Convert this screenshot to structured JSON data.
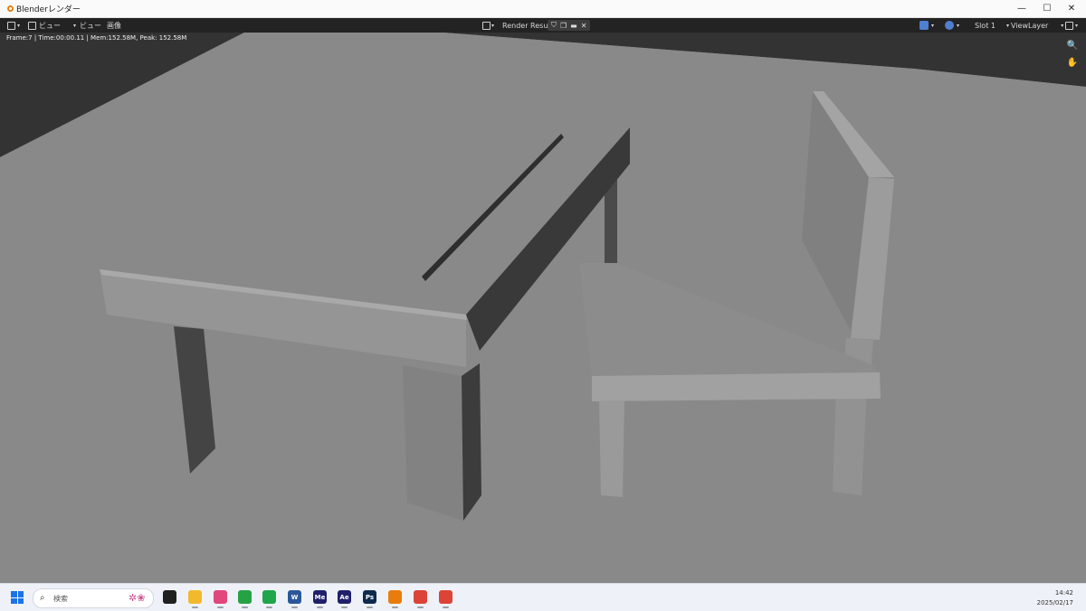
{
  "window": {
    "title": "Blenderレンダー",
    "controls": [
      "—",
      "☐",
      "✕"
    ]
  },
  "header": {
    "menu_view_1": "ビュー",
    "menu_view_2": "ビュー",
    "menu_image": "画像",
    "render_result": "Render Result",
    "slot": "Slot 1",
    "view_layer": "ViewLayer"
  },
  "viewport": {
    "stats": "Frame:7 | Time:00:00.11 | Mem:152.58M, Peak: 152.58M",
    "zoom_icon": "🔍",
    "pan_icon": "✋"
  },
  "taskbar": {
    "search_placeholder": "検索",
    "apps": [
      {
        "name": "task-view",
        "label": "",
        "color": "#202020"
      },
      {
        "name": "file-explorer",
        "label": "",
        "color": "#f2b92c"
      },
      {
        "name": "snipping-tool",
        "label": "",
        "color": "#e1467c"
      },
      {
        "name": "eye-app",
        "label": "",
        "color": "#25a244"
      },
      {
        "name": "messages",
        "label": "",
        "color": "#1fa64a"
      },
      {
        "name": "word",
        "label": "W",
        "color": "#2b579a"
      },
      {
        "name": "media-encoder",
        "label": "Me",
        "color": "#1f1f6b"
      },
      {
        "name": "after-effects",
        "label": "Ae",
        "color": "#1f1f6b"
      },
      {
        "name": "photoshop",
        "label": "Ps",
        "color": "#0e2a4d"
      },
      {
        "name": "blender",
        "label": "",
        "color": "#e87d0d"
      },
      {
        "name": "chrome-1",
        "label": "",
        "color": "#db4437"
      },
      {
        "name": "chrome-2",
        "label": "",
        "color": "#db4437"
      }
    ],
    "time": "14:42",
    "date": "2025/02/17"
  }
}
